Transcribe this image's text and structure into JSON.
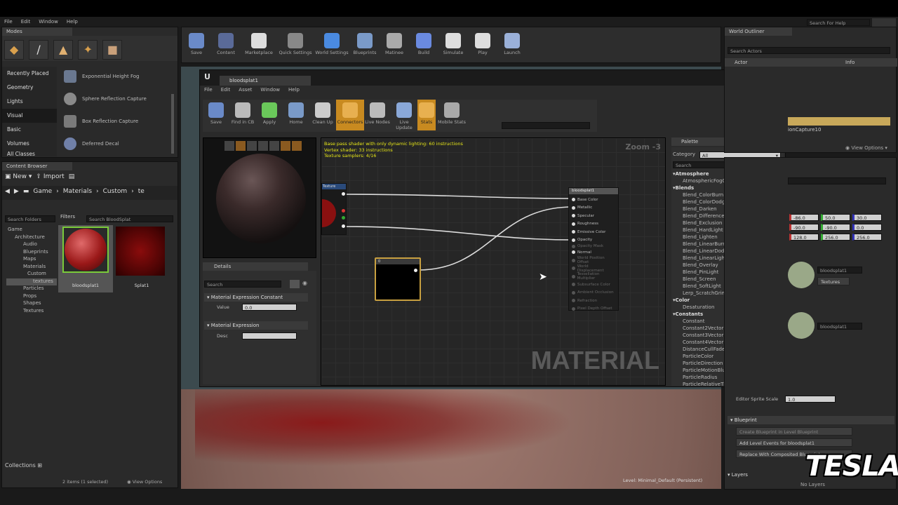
{
  "menu": [
    "File",
    "Edit",
    "Window",
    "Help"
  ],
  "search_top": "Search For Help",
  "modes": {
    "tab": "Modes",
    "categories": [
      "Recently Placed",
      "Geometry",
      "Lights",
      "Visual",
      "Basic",
      "Volumes",
      "All Classes"
    ],
    "items": [
      "Exponential Height Fog",
      "Sphere Reflection Capture",
      "Box Reflection Capture",
      "Deferred Decal"
    ]
  },
  "toolbar": [
    "Save",
    "Content",
    "Marketplace",
    "Quick Settings",
    "World Settings",
    "Blueprints",
    "Matinee",
    "Build",
    "Simulate",
    "Play",
    "Launch"
  ],
  "content_browser": {
    "tab": "Content Browser",
    "new_label": "New",
    "import_label": "Import",
    "path": [
      "Game",
      "Materials",
      "Custom",
      "te"
    ],
    "search": "Search Folders",
    "filters": "Filters",
    "search_assets": "Search BloodSplat",
    "tree": [
      "Game",
      "Architecture",
      "Audio",
      "Blueprints",
      "Maps",
      "Materials",
      "Custom",
      "textures",
      "Particles",
      "Props",
      "Shapes",
      "Textures"
    ],
    "assets": [
      "bloodsplat1",
      "Splat1"
    ],
    "collections": "Collections",
    "status": "2 items (1 selected)",
    "view_options": "View Options"
  },
  "material_editor": {
    "tab": "bloodsplat1",
    "menu": [
      "File",
      "Edit",
      "Asset",
      "Window",
      "Help"
    ],
    "toolbar": [
      "Save",
      "Find in CB",
      "Apply",
      "Home",
      "Clean Up",
      "Connectors",
      "Live Nodes",
      "Live Update",
      "Stats",
      "Mobile Stats"
    ],
    "stats": [
      "Base pass shader with only dynamic lighting: 60 instructions",
      "Vertex shader: 33 instructions",
      "Texture samplers: 4/16"
    ],
    "zoom": "Zoom -3",
    "watermark": "MATERIAL",
    "node_tex_label": "Texture",
    "node_const": "0",
    "result_node": "bloodsplat1",
    "pins": [
      "Base Color",
      "Metallic",
      "Specular",
      "Roughness",
      "Emissive Color",
      "Opacity",
      "Opacity Mask",
      "Normal",
      "World Position Offset",
      "World Displacement",
      "Tessellation Multiplier",
      "Subsurface Color",
      "Ambient Occlusion",
      "Refraction",
      "Pixel Depth Offset"
    ],
    "details_tab": "Details",
    "details_search": "Search",
    "section1": "Material Expression Constant",
    "value_label": "Value",
    "value": "0.0",
    "section2": "Material Expression",
    "desc_label": "Desc",
    "palette_tab": "Palette",
    "category_label": "Category",
    "category_value": "All",
    "palette_search": "Search",
    "palette": [
      {
        "t": "Atmosphere",
        "h": true
      },
      {
        "t": "AtmosphericFogColor"
      },
      {
        "t": "Blends",
        "h": true
      },
      {
        "t": "Blend_ColorBurn"
      },
      {
        "t": "Blend_ColorDodge"
      },
      {
        "t": "Blend_Darken"
      },
      {
        "t": "Blend_Difference"
      },
      {
        "t": "Blend_Exclusion"
      },
      {
        "t": "Blend_HardLight"
      },
      {
        "t": "Blend_Lighten"
      },
      {
        "t": "Blend_LinearBurn"
      },
      {
        "t": "Blend_LinearDodge"
      },
      {
        "t": "Blend_LinearLight"
      },
      {
        "t": "Blend_Overlay"
      },
      {
        "t": "Blend_PinLight"
      },
      {
        "t": "Blend_Screen"
      },
      {
        "t": "Blend_SoftLight"
      },
      {
        "t": "Lerp_ScratchGrime"
      },
      {
        "t": "Color",
        "h": true
      },
      {
        "t": "Desaturation"
      },
      {
        "t": "Constants",
        "h": true
      },
      {
        "t": "Constant",
        "n": "1"
      },
      {
        "t": "Constant2Vector",
        "n": "2"
      },
      {
        "t": "Constant3Vector",
        "n": "3"
      },
      {
        "t": "Constant4Vector",
        "n": "4"
      },
      {
        "t": "DistanceCullFade"
      },
      {
        "t": "ParticleColor"
      },
      {
        "t": "ParticleDirection"
      },
      {
        "t": "ParticleMotionBlurFade"
      },
      {
        "t": "ParticleRadius"
      },
      {
        "t": "ParticleRelativeTime"
      }
    ]
  },
  "world_outliner": {
    "tab": "World Outliner",
    "search": "Search Actors",
    "col_actor": "Actor",
    "col_info": "Info",
    "selected_row": "ionCapture10",
    "view_options": "View Options"
  },
  "details_right": {
    "transform": [
      [
        "-86.0",
        "50.0",
        "30.0"
      ],
      [
        "-90.0",
        "-90.0",
        "0.0"
      ],
      [
        "128.0",
        "256.0",
        "256.0"
      ]
    ],
    "material_name": "bloodsplat1",
    "textures": "Textures",
    "editor_sprite": "Editor Sprite Scale",
    "sprite_value": "1.0",
    "blueprint": "Blueprint",
    "bp1": "Create Blueprint in Level Blueprint",
    "bp2": "Add Level Events for bloodsplat1",
    "bp3": "Replace With Composited Blueprint",
    "layers": "Layers",
    "no_layers": "No Layers"
  },
  "viewport_status": "Level:  Minimal_Default (Persistent)",
  "brand": "TESLA"
}
